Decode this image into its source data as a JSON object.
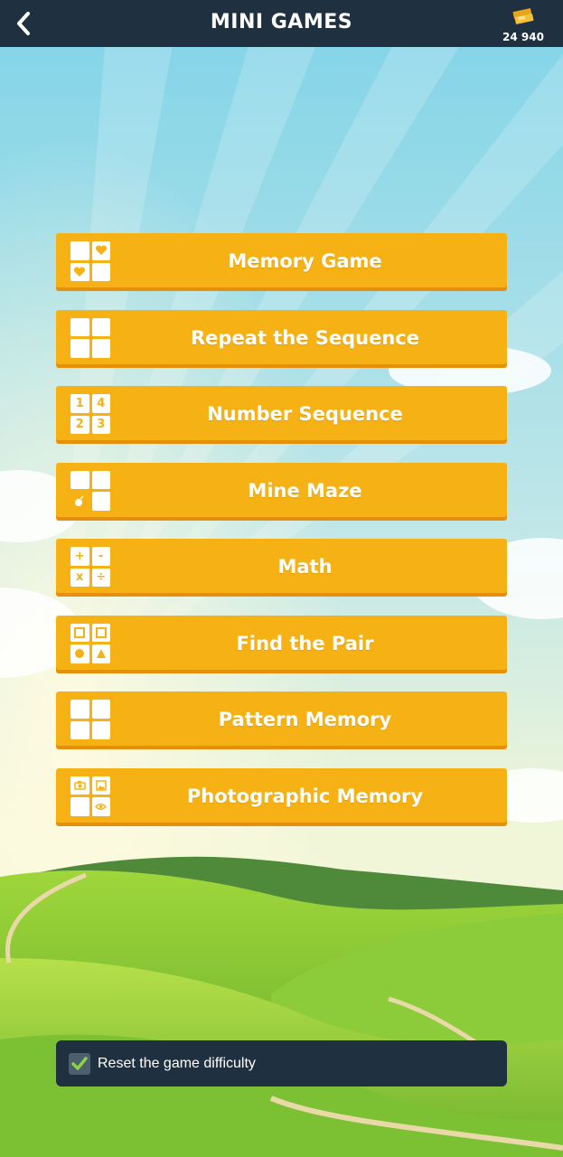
{
  "header": {
    "title": "MINI GAMES",
    "back_icon": "chevron-left-icon",
    "coins_icon": "tickets-icon",
    "coins": "24 940"
  },
  "games": [
    {
      "label": "Memory Game",
      "icon": "memory-grid-icon"
    },
    {
      "label": "Repeat the Sequence",
      "icon": "sequence-grid-icon"
    },
    {
      "label": "Number Sequence",
      "icon": "number-grid-icon",
      "cells": [
        "1",
        "4",
        "2",
        "3"
      ]
    },
    {
      "label": "Mine Maze",
      "icon": "mine-grid-icon"
    },
    {
      "label": "Math",
      "icon": "math-grid-icon",
      "cells": [
        "+",
        "-",
        "x",
        "÷"
      ]
    },
    {
      "label": "Find the Pair",
      "icon": "shapes-grid-icon"
    },
    {
      "label": "Pattern Memory",
      "icon": "pattern-grid-icon"
    },
    {
      "label": "Photographic Memory",
      "icon": "photo-grid-icon"
    }
  ],
  "reset": {
    "label": "Reset the game difficulty",
    "checked": true
  },
  "colors": {
    "header_bg": "#1f3140",
    "button": "#f6b214",
    "button_shadow": "#e58f0c",
    "check": "#8bd34a"
  }
}
